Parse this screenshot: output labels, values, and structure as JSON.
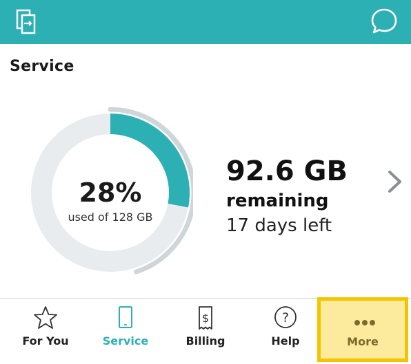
{
  "header": {
    "left_icon": "app-switch-icon",
    "right_icon": "chat-bubble-icon",
    "colors": {
      "background": "#2db0b4",
      "icon": "#ffffff"
    }
  },
  "service": {
    "title": "Service",
    "usage_percent_label": "28%",
    "usage_percent": 28,
    "usage_caption": "used of 128 GB",
    "remaining_amount": "92.6 GB",
    "remaining_label": "remaining",
    "days_left": "17 days left",
    "time_elapsed_fraction": 0.45,
    "colors": {
      "used": "#2db0b4",
      "track": "#e8ecee",
      "time": "#cfd6d9"
    }
  },
  "bottom_nav": {
    "items": [
      {
        "label": "For You",
        "icon": "star-icon",
        "active": false
      },
      {
        "label": "Service",
        "icon": "tablet-icon",
        "active": true
      },
      {
        "label": "Billing",
        "icon": "bill-dollar-icon",
        "active": false
      },
      {
        "label": "Help",
        "icon": "question-circle-icon",
        "active": false
      },
      {
        "label": "More",
        "icon": "more-dots-icon",
        "active": false,
        "highlighted": true
      }
    ],
    "colors": {
      "active": "#2db0b4",
      "highlight_bg": "#fdeb9d",
      "highlight_border": "#f5c400"
    }
  }
}
